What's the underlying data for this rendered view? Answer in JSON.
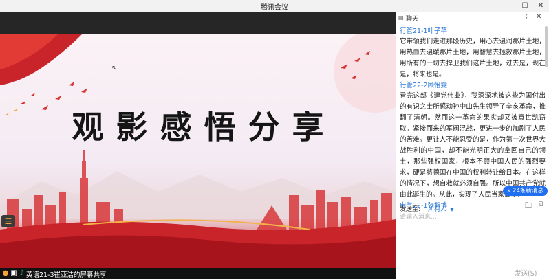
{
  "window": {
    "title": "腾讯会议",
    "buttons": {
      "minimize": "─",
      "maximize": "☐",
      "close": "✕"
    }
  },
  "slide": {
    "title": "观影感悟分享"
  },
  "statusbar": {
    "share_label": "英语21-3崔亚洁的屏幕共享"
  },
  "chat": {
    "header_label": "聊天",
    "messages": [
      {
        "sender": "行管21-1叶子芊",
        "text": "它带领我们走进那段历史，用心去温润那片土地，用热血去温暖那片土地，用智慧去拯救那片土地，用所有的一切去捍卫我们这片土地，过去是，现在是，将来也是。"
      },
      {
        "sender": "行管22-2顾怡雯",
        "text": "看完这部《建党伟业》，我深深地被这些为国付出的有识之士所感动孙中山先生领导了辛亥革命，推翻了清朝。然而这一革命的果实却又被袁世凯窃取。紧接而来的军阀混战，更进一步的加剧了人民的苦难。更让人不能忍受的是，作为第一次世界大战胜利的中国，却不能光明正大的拿回自己的领土，那些强权国家，根本不顾中国人民的强烈要求，硬是将德国在中国的权利转让给日本。在这样的情况下，想自救就必须自强。所以中国共产党就由此诞生的。从此，实现了人民当家做主!"
      },
      {
        "sender": "电气22-1张智博",
        "text": ""
      }
    ],
    "new_messages": "24条新消息",
    "send_to_label": "发送至:",
    "recipient": "所有人",
    "input_placeholder": "请输入消息...",
    "send_button": "发送(S)"
  },
  "colors": {
    "accent_blue": "#2a78d6",
    "badge_blue": "#1f6ff0",
    "slide_red": "#c8242a"
  }
}
